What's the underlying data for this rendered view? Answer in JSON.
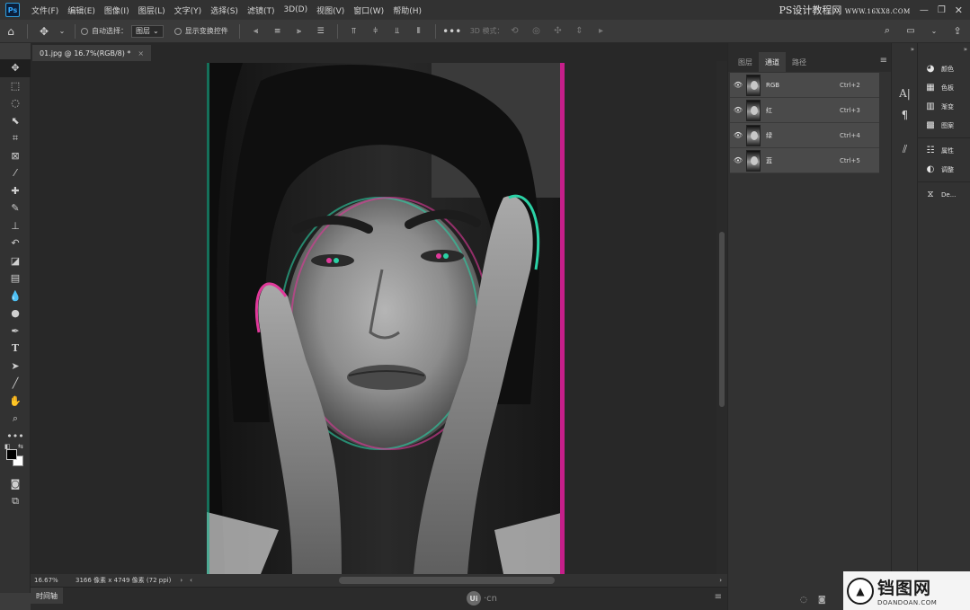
{
  "app": {
    "logo": "Ps"
  },
  "menu": [
    "文件(F)",
    "编辑(E)",
    "图像(I)",
    "图层(L)",
    "文字(Y)",
    "选择(S)",
    "滤镜(T)",
    "3D(D)",
    "视图(V)",
    "窗口(W)",
    "帮助(H)"
  ],
  "watermark_top": {
    "main": "PS设计教程网",
    "sub": "WWW.16XX8.COM"
  },
  "options": {
    "auto_select_label": "自动选择：",
    "auto_select_value": "图层",
    "show_transform_label": "显示变换控件",
    "mode_3d_label": "3D 模式："
  },
  "document": {
    "tab_title": "01.jpg @ 16.7%(RGB/8) *"
  },
  "status": {
    "zoom": "16.67%",
    "info": "3166 像素 x 4749 像素 (72 ppi)"
  },
  "timeline": {
    "label": "时间轴"
  },
  "watermark_center": {
    "disc": "Ui",
    "text": "·cn"
  },
  "panel": {
    "tabs": [
      "图层",
      "通道",
      "路径"
    ],
    "active_tab": 1,
    "channels": [
      {
        "name": "RGB",
        "shortcut": "Ctrl+2"
      },
      {
        "name": "红",
        "shortcut": "Ctrl+3"
      },
      {
        "name": "绿",
        "shortcut": "Ctrl+4"
      },
      {
        "name": "蓝",
        "shortcut": "Ctrl+5"
      }
    ]
  },
  "right_panel": {
    "items": [
      {
        "label": "颜色",
        "icon": "color-icon"
      },
      {
        "label": "色板",
        "icon": "swatches-icon"
      },
      {
        "label": "渐变",
        "icon": "gradient-icon"
      },
      {
        "label": "图案",
        "icon": "pattern-icon"
      },
      {
        "label": "属性",
        "icon": "properties-icon"
      },
      {
        "label": "调整",
        "icon": "adjustments-icon"
      },
      {
        "label": "De...",
        "icon": "device-preview-icon"
      }
    ]
  },
  "watermark_corner": {
    "big": "铛图网",
    "small": "DOANDOAN.COM"
  }
}
